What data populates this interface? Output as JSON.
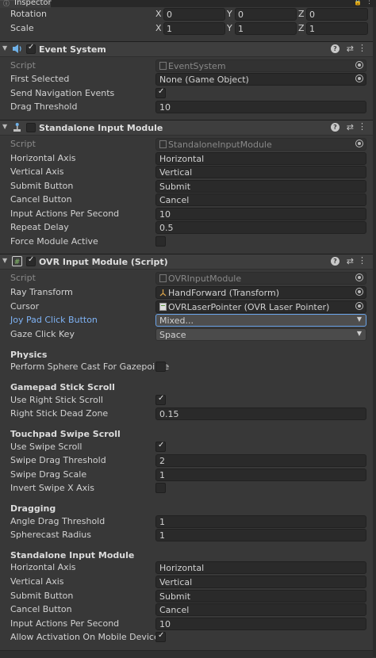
{
  "tab": {
    "title": "Inspector"
  },
  "transform": {
    "rotation": {
      "label": "Rotation",
      "x": "0",
      "y": "0",
      "z": "0"
    },
    "scale": {
      "label": "Scale",
      "x": "1",
      "y": "1",
      "z": "1"
    }
  },
  "axes": {
    "x": "X",
    "y": "Y",
    "z": "Z"
  },
  "event_system": {
    "title": "Event System",
    "script_label": "Script",
    "script_value": "EventSystem",
    "first_selected_label": "First Selected",
    "first_selected_value": "None (Game Object)",
    "send_nav_label": "Send Navigation Events",
    "drag_threshold_label": "Drag Threshold",
    "drag_threshold_value": "10"
  },
  "standalone": {
    "title": "Standalone Input Module",
    "script_label": "Script",
    "script_value": "StandaloneInputModule",
    "horizontal_axis_label": "Horizontal Axis",
    "horizontal_axis_value": "Horizontal",
    "vertical_axis_label": "Vertical Axis",
    "vertical_axis_value": "Vertical",
    "submit_label": "Submit Button",
    "submit_value": "Submit",
    "cancel_label": "Cancel Button",
    "cancel_value": "Cancel",
    "ips_label": "Input Actions Per Second",
    "ips_value": "10",
    "repeat_label": "Repeat Delay",
    "repeat_value": "0.5",
    "force_label": "Force Module Active"
  },
  "ovr": {
    "title": "OVR Input Module (Script)",
    "script_label": "Script",
    "script_value": "OVRInputModule",
    "ray_label": "Ray Transform",
    "ray_value": "HandForward (Transform)",
    "cursor_label": "Cursor",
    "cursor_value": "OVRLaserPointer (OVR Laser Pointer)",
    "joypad_label": "Joy Pad Click Button",
    "joypad_value": "Mixed...",
    "gaze_label": "Gaze Click Key",
    "gaze_value": "Space",
    "physics_header": "Physics",
    "sphere_label": "Perform Sphere Cast For Gazepointe",
    "gamepad_header": "Gamepad Stick Scroll",
    "use_right_label": "Use Right Stick Scroll",
    "dead_zone_label": "Right Stick Dead Zone",
    "dead_zone_value": "0.15",
    "touchpad_header": "Touchpad Swipe Scroll",
    "use_swipe_label": "Use Swipe Scroll",
    "swipe_thresh_label": "Swipe Drag Threshold",
    "swipe_thresh_value": "2",
    "swipe_scale_label": "Swipe Drag Scale",
    "swipe_scale_value": "1",
    "invert_label": "Invert Swipe X Axis",
    "dragging_header": "Dragging",
    "angle_label": "Angle Drag Threshold",
    "angle_value": "1",
    "spherecast_label": "Spherecast Radius",
    "spherecast_value": "1",
    "sim_header": "Standalone Input Module",
    "h_axis_label": "Horizontal Axis",
    "h_axis_value": "Horizontal",
    "v_axis_label": "Vertical Axis",
    "v_axis_value": "Vertical",
    "submit_label": "Submit Button",
    "submit_value": "Submit",
    "cancel_label": "Cancel Button",
    "cancel_value": "Cancel",
    "ips_label": "Input Actions Per Second",
    "ips_value": "10",
    "allow_label": "Allow Activation On Mobile Device"
  },
  "icons": {
    "check": "✓",
    "help": "?",
    "settings": "⇄",
    "kebab": "⋮",
    "caret": "▼",
    "fold": "▼"
  }
}
